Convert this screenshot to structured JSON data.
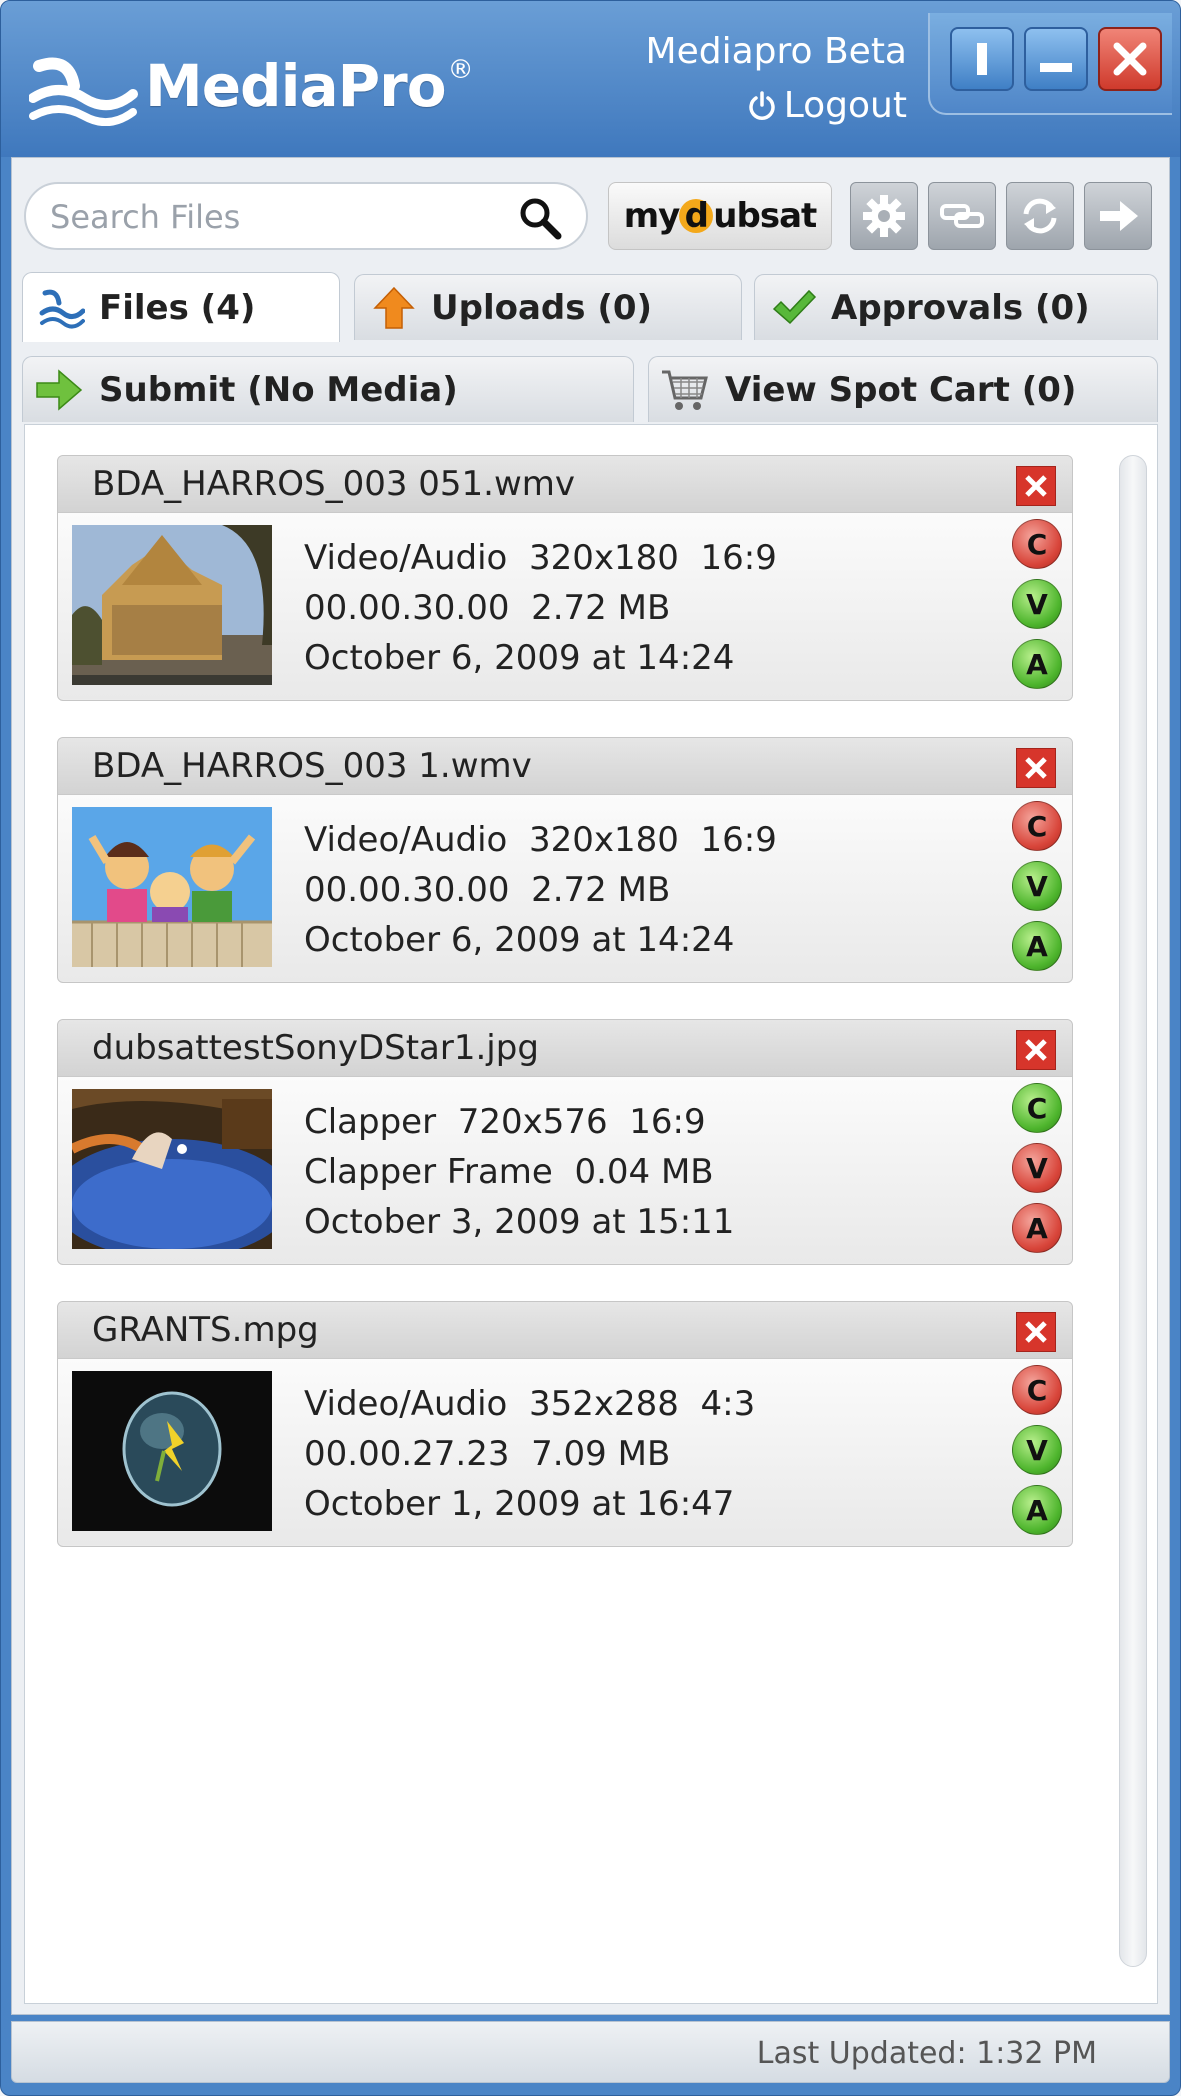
{
  "app": {
    "logo_text": "MediaPro",
    "logo_reg": "®",
    "user_name": "Mediapro Beta",
    "logout_label": "Logout"
  },
  "toolbar": {
    "search_placeholder": "Search Files",
    "mydubsat_prefix": "my",
    "mydubsat_d": "d",
    "mydubsat_suffix": "ubsat"
  },
  "tabs": [
    {
      "label": "Files (4)",
      "icon": "wave-icon"
    },
    {
      "label": "Uploads (0)",
      "icon": "upload-arrow-icon"
    },
    {
      "label": "Approvals (0)",
      "icon": "checkmark-icon"
    }
  ],
  "subtabs": [
    {
      "label": "Submit (No Media)",
      "icon": "right-arrow-icon"
    },
    {
      "label": "View Spot Cart (0)",
      "icon": "cart-icon"
    }
  ],
  "files": [
    {
      "name": "BDA_HARROS_003 051.wmv",
      "line1": "Video/Audio  320x180  16:9",
      "line2": "00.00.30.00  2.72 MB",
      "line3": "October 6, 2009 at 14:24",
      "status": [
        {
          "letter": "C",
          "color": "red"
        },
        {
          "letter": "V",
          "color": "green"
        },
        {
          "letter": "A",
          "color": "green"
        }
      ]
    },
    {
      "name": "BDA_HARROS_003 1.wmv",
      "line1": "Video/Audio  320x180  16:9",
      "line2": "00.00.30.00  2.72 MB",
      "line3": "October 6, 2009 at 14:24",
      "status": [
        {
          "letter": "C",
          "color": "red"
        },
        {
          "letter": "V",
          "color": "green"
        },
        {
          "letter": "A",
          "color": "green"
        }
      ]
    },
    {
      "name": "dubsattestSonyDStar1.jpg",
      "line1": "Clapper  720x576  16:9",
      "line2": "Clapper Frame  0.04 MB",
      "line3": "October 3, 2009 at 15:11",
      "status": [
        {
          "letter": "C",
          "color": "green"
        },
        {
          "letter": "V",
          "color": "red"
        },
        {
          "letter": "A",
          "color": "red"
        }
      ]
    },
    {
      "name": "GRANTS.mpg",
      "line1": "Video/Audio  352x288  4:3",
      "line2": "00.00.27.23  7.09 MB",
      "line3": "October 1, 2009 at 16:47",
      "status": [
        {
          "letter": "C",
          "color": "red"
        },
        {
          "letter": "V",
          "color": "green"
        },
        {
          "letter": "A",
          "color": "green"
        }
      ]
    }
  ],
  "statusbar": {
    "last_updated": "Last Updated: 1:32 PM"
  }
}
